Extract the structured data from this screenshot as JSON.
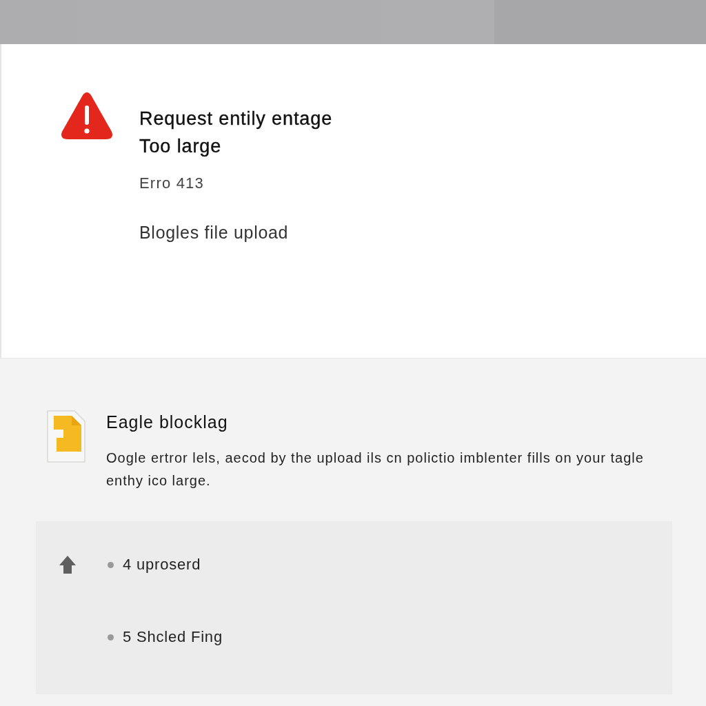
{
  "error": {
    "title_lines": [
      "Request entily entage",
      "Too large"
    ],
    "code": "Erro 413",
    "subtitle": "Blogles file upload"
  },
  "details": {
    "heading": "Eagle blocklag",
    "description": "Oogle ertror lels, aecod by the upload ils cn polictio imblenter fills on your tagle enthy ico large."
  },
  "panel": {
    "items": [
      {
        "text": "4 uproserd"
      },
      {
        "text": "5 Shcled Fing"
      }
    ]
  }
}
